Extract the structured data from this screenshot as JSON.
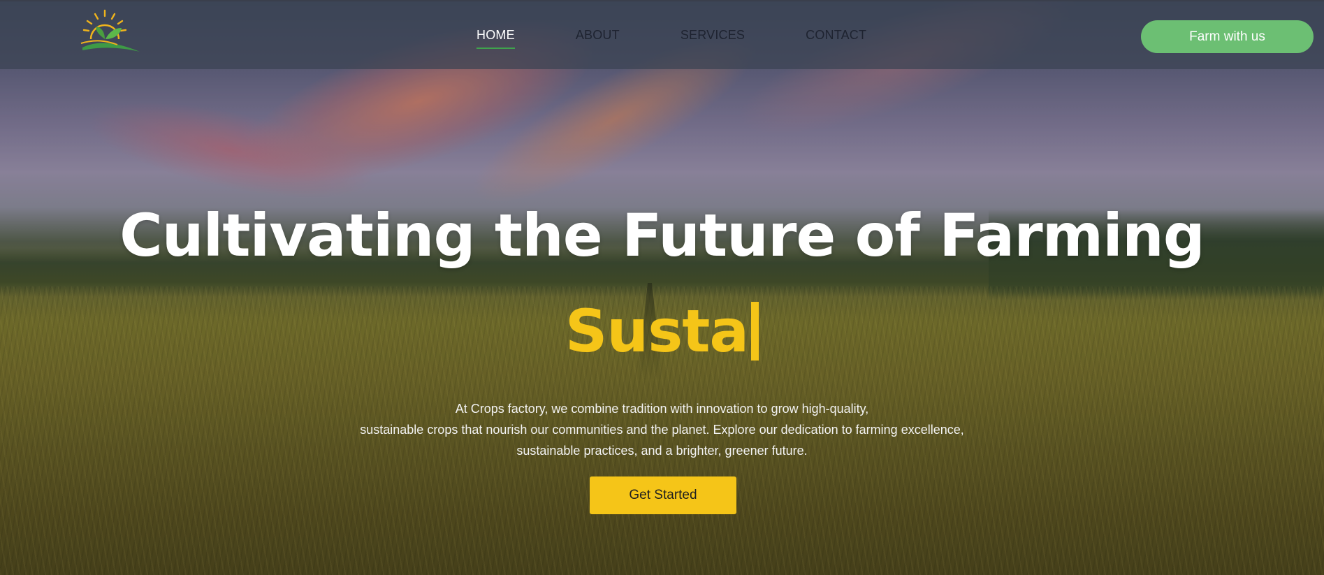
{
  "nav": {
    "links": [
      {
        "label": "HOME",
        "active": true
      },
      {
        "label": "ABOUT",
        "active": false
      },
      {
        "label": "SERVICES",
        "active": false
      },
      {
        "label": "CONTACT",
        "active": false
      }
    ],
    "cta_label": "Farm with us"
  },
  "logo": {
    "icon": "sun-leaf-logo"
  },
  "hero": {
    "headline": "Cultivating the Future of Farming",
    "typed_text": "Susta",
    "description_lines": [
      "At Crops factory, we combine tradition with innovation to grow high-quality,",
      "sustainable  crops that nourish our communities and the planet. Explore our dedication to farming excellence,",
      "sustainable practices, and a brighter, greener future."
    ],
    "cta_label": "Get Started"
  },
  "colors": {
    "accent_yellow": "#f5c518",
    "accent_green": "#6cbf73",
    "active_underline": "#3fa34d"
  }
}
